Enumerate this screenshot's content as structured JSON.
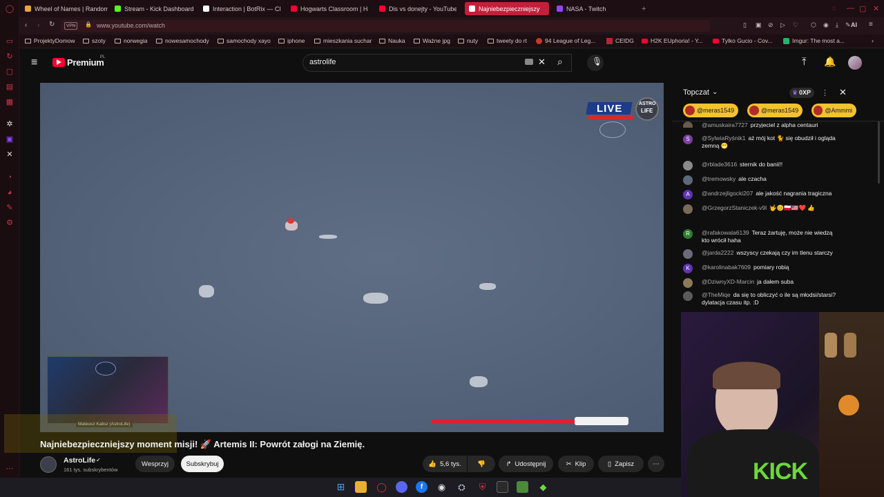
{
  "browser": {
    "tabs": [
      {
        "label": "Wheel of Names | Random",
        "color": "#e8a33b"
      },
      {
        "label": "Stream - Kick Dashboard",
        "color": "#53fc18"
      },
      {
        "label": "Interaction | BotRix — Clo",
        "color": "#ffffff"
      },
      {
        "label": "Hogwarts Classroom | Ha",
        "color": "#ff0033"
      },
      {
        "label": "Dis vs donejty - YouTube",
        "color": "#ff0033"
      },
      {
        "label": "Najniebezpieczniejszy",
        "color": "#ff0033",
        "active": true
      },
      {
        "label": "NASA - Twitch",
        "color": "#9146ff"
      }
    ],
    "new_tab": "+",
    "vpn_badge": "VPN",
    "url": "www.youtube.com/watch",
    "ai_label": "AI",
    "bookmarks": [
      {
        "label": "ProjektyDomow",
        "type": "folder"
      },
      {
        "label": "szoty",
        "type": "folder"
      },
      {
        "label": "norwegia",
        "type": "folder"
      },
      {
        "label": "nowesamochody",
        "type": "folder"
      },
      {
        "label": "samochody xayo",
        "type": "folder"
      },
      {
        "label": "iphone",
        "type": "folder"
      },
      {
        "label": "mieszkania suchar",
        "type": "folder"
      },
      {
        "label": "Nauka",
        "type": "folder"
      },
      {
        "label": "Ważne jpg",
        "type": "folder"
      },
      {
        "label": "nuty",
        "type": "folder"
      },
      {
        "label": "tweety do rt",
        "type": "folder"
      },
      {
        "label": "94 League of Leg...",
        "type": "site"
      },
      {
        "label": "CEIDG",
        "type": "site"
      },
      {
        "label": "H2K EUphoria! - Y...",
        "type": "site"
      },
      {
        "label": "Tylko Gucio - Cov...",
        "type": "site"
      },
      {
        "label": "Imgur: The most a...",
        "type": "site"
      }
    ]
  },
  "youtube": {
    "logo": "Premium",
    "logo_sup": "PL",
    "search_value": "astrolife",
    "video": {
      "live_badge": "LIVE",
      "brand_line1": "ASTRO",
      "brand_line2": "LIFE",
      "pip_caption": "Mateusz Kalisz (AstroLife)",
      "title": "Najniebezpieczniejszy moment misji! 🚀 Artemis II: Powrót załogi na Ziemię."
    },
    "channel": {
      "name": "AstroLife",
      "subscribers": "161 tys. subskrybentów",
      "support_label": "Wesprzyj",
      "subscribe_label": "Subskrybuj"
    },
    "actions": {
      "likes": "5,6 tys.",
      "share": "Udostępnij",
      "clip": "Klip",
      "save": "Zapisz"
    },
    "chat": {
      "header": "Topczat",
      "points": "0XP",
      "pinned": [
        "@meras1549",
        "@meras1549",
        "@Ammmi"
      ],
      "messages": [
        {
          "author": "@amuskaira7727",
          "text": "przyjeciel z alpha centauri",
          "avatar": "",
          "avatar_color": "#6a5a4a"
        },
        {
          "author": "@SylwiaRyśnik1",
          "text": "aż mój kot 🐈 się obudził i ogląda zemną 😁",
          "avatar": "S",
          "avatar_color": "#7b3fa0"
        },
        {
          "author": "@rblade3616",
          "text": "sternik do banii!!",
          "avatar": "",
          "avatar_color": "#8a8a8a"
        },
        {
          "author": "@tremowsky",
          "text": "ale czacha",
          "avatar": "",
          "avatar_color": "#5a6a7a"
        },
        {
          "author": "@andrzejligocki207",
          "text": "ale jakość nagrania tragiczna",
          "avatar": "A",
          "avatar_color": "#5e35b1"
        },
        {
          "author": "@GrzegorzStaniczek-v9l",
          "text": "🤟😊🇵🇱🇺🇸❤️ 👍",
          "avatar": "",
          "avatar_color": "#7a6a5a"
        },
        {
          "author": "@rafakowala6139",
          "text": "Teraz żartuję, może nie wiedzą kto wrócił haha",
          "avatar": "R",
          "avatar_color": "#2e7d32"
        },
        {
          "author": "@jarda2222",
          "text": "wszyscy czekają czy im tlenu starczy",
          "avatar": "",
          "avatar_color": "#6a6a7a"
        },
        {
          "author": "@karolinabak7609",
          "text": "pomiary robią",
          "avatar": "K",
          "avatar_color": "#5e35b1"
        },
        {
          "author": "@DziwnyXD-Marcin",
          "text": "ja dałem suba",
          "avatar": "",
          "avatar_color": "#8a7a5a"
        },
        {
          "author": "@TheMiqe",
          "text": "da się to obliczyć o ile są młodsi/starsi? dylatacja czasu itp. :D",
          "avatar": "",
          "avatar_color": "#5a5a5a"
        }
      ]
    }
  },
  "webcam": {
    "shirt_text": "KICK"
  }
}
